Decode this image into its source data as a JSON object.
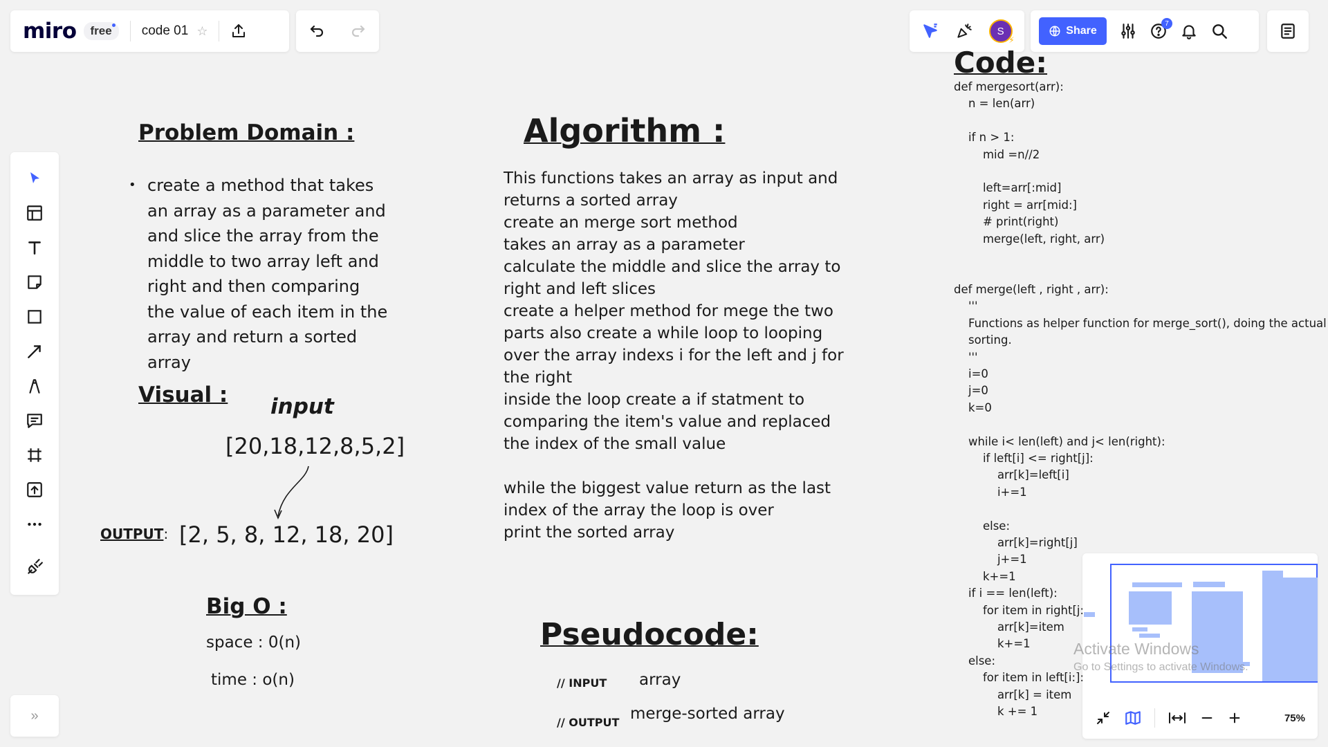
{
  "toolbar": {
    "logo": "miro",
    "plan": "free",
    "board_name": "code 01"
  },
  "topright": {
    "avatar_initial": "S",
    "share_label": "Share",
    "help_badge": "7"
  },
  "tools": [
    "select-tool",
    "templates-tool",
    "text-tool",
    "sticky-note-tool",
    "shape-tool",
    "connection-line-tool",
    "pen-tool",
    "comment-tool",
    "frame-tool",
    "upload-tool",
    "more-tools",
    "apps-tool"
  ],
  "board": {
    "problem_domain": {
      "title": "Problem Domain :",
      "items": [
        "create a method that takes an array as a parameter and and slice the array from the middle to two array left and right and then comparing the value of each item in the array and return a sorted array"
      ]
    },
    "visual": {
      "title": "Visual :",
      "input_label": "input",
      "input": "[20,18,12,8,5,2]",
      "output_label": "OUTPUT",
      "output_colon": ":",
      "output": "[2, 5, 8, 12, 18, 20]"
    },
    "big_o": {
      "title": "Big O :",
      "space": "space : 0(n)",
      "time": "time : o(n)"
    },
    "algorithm": {
      "title": "Algorithm :",
      "para1": "This functions takes an array as input and returns a sorted array\ncreate an merge sort method\ntakes an array as a parameter\ncalculate the middle and slice the array to right and left slices\ncreate a helper method for mege the two parts also create a while loop to looping over the array indexs i for the left and j for the right\ninside the loop create a if statment to comparing the item's value and replaced the index of the small value",
      "para2": "while the biggest value return as the last index of the array the loop is over\nprint the sorted array"
    },
    "pseudocode": {
      "title": "Pseudocode:",
      "input_label": "// INPUT",
      "input_value": "array",
      "output_label": "// OUTPUT",
      "output_value": "merge-sorted array"
    },
    "code": {
      "title": "Code:",
      "body": "def mergesort(arr):\n    n = len(arr)\n\n    if n > 1:\n        mid =n//2\n\n        left=arr[:mid]\n        right = arr[mid:]\n        # print(right)\n        merge(left, right, arr)\n\n\ndef merge(left , right , arr):\n    '''\n    Functions as helper function for merge_sort(), doing the actual\n    sorting.\n    '''\n    i=0\n    j=0\n    k=0\n\n    while i< len(left) and j< len(right):\n        if left[i] <= right[j]:\n            arr[k]=left[i]\n            i+=1\n\n        else:\n            arr[k]=right[j]\n            j+=1\n        k+=1\n    if i == len(left):\n        for item in right[j:]:\n            arr[k]=item\n            k+=1\n    else:\n        for item in left[i:]:\n            arr[k] = item\n            k += 1"
    }
  },
  "minimap": {
    "zoom": "75%"
  },
  "watermark": {
    "line1": "Activate Windows",
    "line2": "Go to Settings to activate Windows."
  }
}
